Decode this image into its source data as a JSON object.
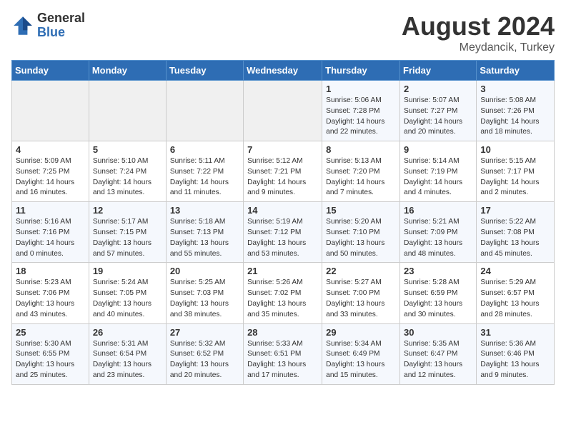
{
  "header": {
    "logo_general": "General",
    "logo_blue": "Blue",
    "month_year": "August 2024",
    "location": "Meydancik, Turkey"
  },
  "weekdays": [
    "Sunday",
    "Monday",
    "Tuesday",
    "Wednesday",
    "Thursday",
    "Friday",
    "Saturday"
  ],
  "weeks": [
    [
      {
        "day": "",
        "info": ""
      },
      {
        "day": "",
        "info": ""
      },
      {
        "day": "",
        "info": ""
      },
      {
        "day": "",
        "info": ""
      },
      {
        "day": "1",
        "info": "Sunrise: 5:06 AM\nSunset: 7:28 PM\nDaylight: 14 hours\nand 22 minutes."
      },
      {
        "day": "2",
        "info": "Sunrise: 5:07 AM\nSunset: 7:27 PM\nDaylight: 14 hours\nand 20 minutes."
      },
      {
        "day": "3",
        "info": "Sunrise: 5:08 AM\nSunset: 7:26 PM\nDaylight: 14 hours\nand 18 minutes."
      }
    ],
    [
      {
        "day": "4",
        "info": "Sunrise: 5:09 AM\nSunset: 7:25 PM\nDaylight: 14 hours\nand 16 minutes."
      },
      {
        "day": "5",
        "info": "Sunrise: 5:10 AM\nSunset: 7:24 PM\nDaylight: 14 hours\nand 13 minutes."
      },
      {
        "day": "6",
        "info": "Sunrise: 5:11 AM\nSunset: 7:22 PM\nDaylight: 14 hours\nand 11 minutes."
      },
      {
        "day": "7",
        "info": "Sunrise: 5:12 AM\nSunset: 7:21 PM\nDaylight: 14 hours\nand 9 minutes."
      },
      {
        "day": "8",
        "info": "Sunrise: 5:13 AM\nSunset: 7:20 PM\nDaylight: 14 hours\nand 7 minutes."
      },
      {
        "day": "9",
        "info": "Sunrise: 5:14 AM\nSunset: 7:19 PM\nDaylight: 14 hours\nand 4 minutes."
      },
      {
        "day": "10",
        "info": "Sunrise: 5:15 AM\nSunset: 7:17 PM\nDaylight: 14 hours\nand 2 minutes."
      }
    ],
    [
      {
        "day": "11",
        "info": "Sunrise: 5:16 AM\nSunset: 7:16 PM\nDaylight: 14 hours\nand 0 minutes."
      },
      {
        "day": "12",
        "info": "Sunrise: 5:17 AM\nSunset: 7:15 PM\nDaylight: 13 hours\nand 57 minutes."
      },
      {
        "day": "13",
        "info": "Sunrise: 5:18 AM\nSunset: 7:13 PM\nDaylight: 13 hours\nand 55 minutes."
      },
      {
        "day": "14",
        "info": "Sunrise: 5:19 AM\nSunset: 7:12 PM\nDaylight: 13 hours\nand 53 minutes."
      },
      {
        "day": "15",
        "info": "Sunrise: 5:20 AM\nSunset: 7:10 PM\nDaylight: 13 hours\nand 50 minutes."
      },
      {
        "day": "16",
        "info": "Sunrise: 5:21 AM\nSunset: 7:09 PM\nDaylight: 13 hours\nand 48 minutes."
      },
      {
        "day": "17",
        "info": "Sunrise: 5:22 AM\nSunset: 7:08 PM\nDaylight: 13 hours\nand 45 minutes."
      }
    ],
    [
      {
        "day": "18",
        "info": "Sunrise: 5:23 AM\nSunset: 7:06 PM\nDaylight: 13 hours\nand 43 minutes."
      },
      {
        "day": "19",
        "info": "Sunrise: 5:24 AM\nSunset: 7:05 PM\nDaylight: 13 hours\nand 40 minutes."
      },
      {
        "day": "20",
        "info": "Sunrise: 5:25 AM\nSunset: 7:03 PM\nDaylight: 13 hours\nand 38 minutes."
      },
      {
        "day": "21",
        "info": "Sunrise: 5:26 AM\nSunset: 7:02 PM\nDaylight: 13 hours\nand 35 minutes."
      },
      {
        "day": "22",
        "info": "Sunrise: 5:27 AM\nSunset: 7:00 PM\nDaylight: 13 hours\nand 33 minutes."
      },
      {
        "day": "23",
        "info": "Sunrise: 5:28 AM\nSunset: 6:59 PM\nDaylight: 13 hours\nand 30 minutes."
      },
      {
        "day": "24",
        "info": "Sunrise: 5:29 AM\nSunset: 6:57 PM\nDaylight: 13 hours\nand 28 minutes."
      }
    ],
    [
      {
        "day": "25",
        "info": "Sunrise: 5:30 AM\nSunset: 6:55 PM\nDaylight: 13 hours\nand 25 minutes."
      },
      {
        "day": "26",
        "info": "Sunrise: 5:31 AM\nSunset: 6:54 PM\nDaylight: 13 hours\nand 23 minutes."
      },
      {
        "day": "27",
        "info": "Sunrise: 5:32 AM\nSunset: 6:52 PM\nDaylight: 13 hours\nand 20 minutes."
      },
      {
        "day": "28",
        "info": "Sunrise: 5:33 AM\nSunset: 6:51 PM\nDaylight: 13 hours\nand 17 minutes."
      },
      {
        "day": "29",
        "info": "Sunrise: 5:34 AM\nSunset: 6:49 PM\nDaylight: 13 hours\nand 15 minutes."
      },
      {
        "day": "30",
        "info": "Sunrise: 5:35 AM\nSunset: 6:47 PM\nDaylight: 13 hours\nand 12 minutes."
      },
      {
        "day": "31",
        "info": "Sunrise: 5:36 AM\nSunset: 6:46 PM\nDaylight: 13 hours\nand 9 minutes."
      }
    ]
  ]
}
